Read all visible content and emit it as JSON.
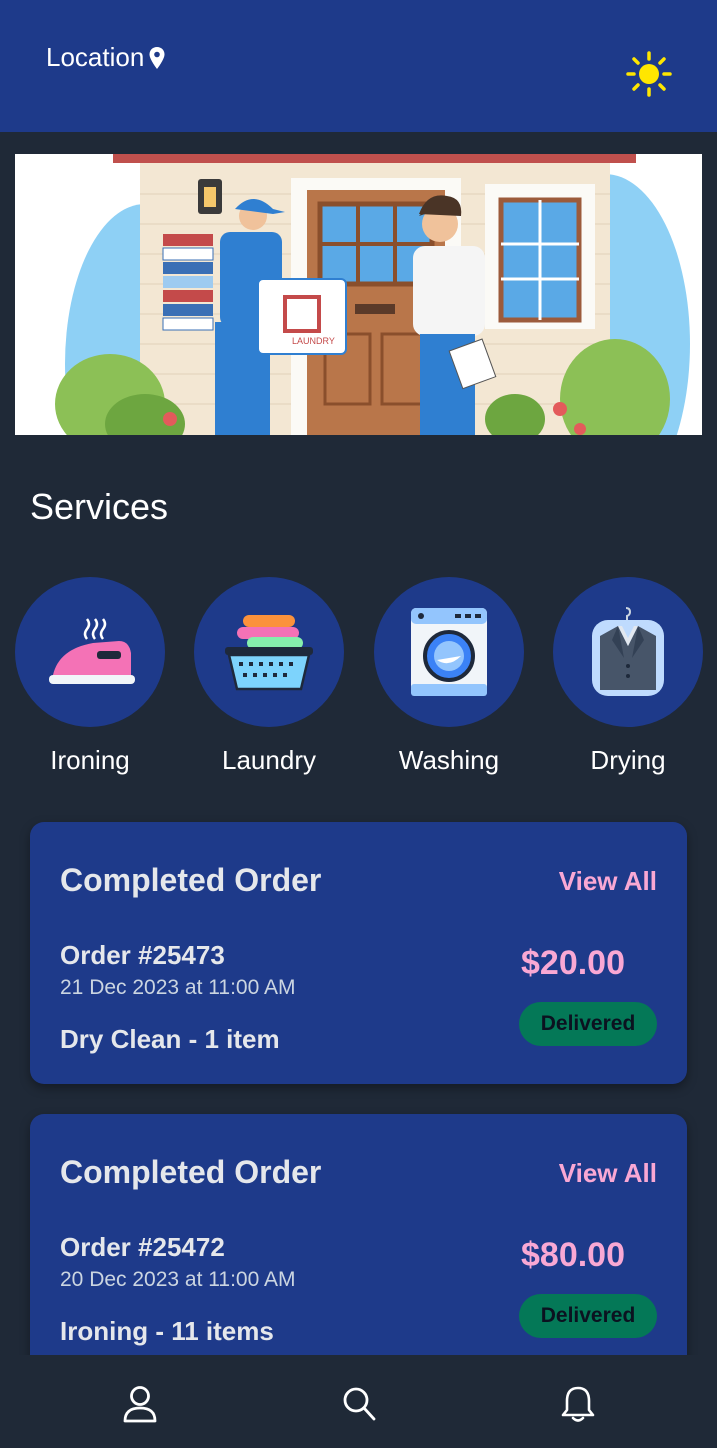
{
  "header": {
    "location_label": "Location",
    "theme_icon": "sun-icon"
  },
  "services": {
    "title": "Services",
    "items": [
      {
        "label": "Ironing",
        "icon": "iron-icon"
      },
      {
        "label": "Laundry",
        "icon": "laundry-basket-icon"
      },
      {
        "label": "Washing",
        "icon": "washing-machine-icon"
      },
      {
        "label": "Drying",
        "icon": "suit-bag-icon"
      }
    ]
  },
  "orders": [
    {
      "title": "Completed Order",
      "view_all": "View All",
      "order_no": "Order #25473",
      "date": "21 Dec 2023 at 11:00 AM",
      "description": "Dry Clean - 1 item",
      "price": "$20.00",
      "status": "Delivered"
    },
    {
      "title": "Completed Order",
      "view_all": "View All",
      "order_no": "Order #25472",
      "date": "20 Dec 2023 at 11:00 AM",
      "description": "Ironing - 11 items",
      "price": "$80.00",
      "status": "Delivered"
    }
  ],
  "nav": {
    "items": [
      "profile-icon",
      "search-icon",
      "bell-icon"
    ]
  },
  "colors": {
    "header_bg": "#1e3a8a",
    "page_bg": "#1f2937",
    "accent_pink": "#f9a8d4",
    "status_green": "#047857"
  }
}
